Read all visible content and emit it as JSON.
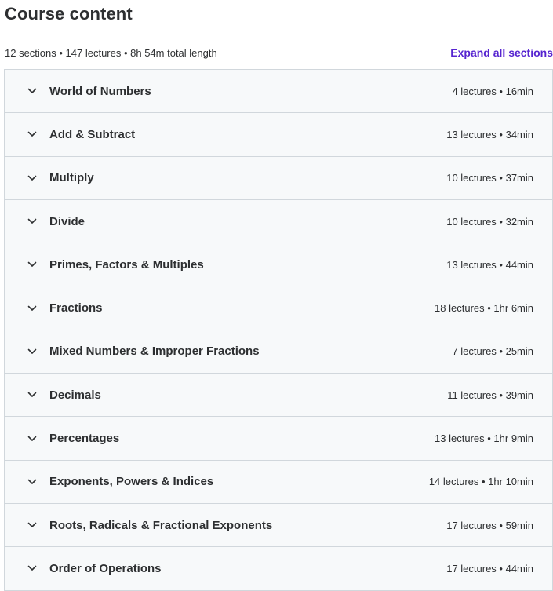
{
  "header": {
    "title": "Course content",
    "summary": "12 sections • 147 lectures • 8h 54m total length",
    "expand_label": "Expand all sections"
  },
  "colors": {
    "accent": "#5624d0",
    "section_bg": "#f7f9fa",
    "border": "#d1d7dc",
    "text": "#2d2f31"
  },
  "sections": [
    {
      "title": "World of Numbers",
      "info": "4 lectures • 16min",
      "icon": "chevron-down-icon"
    },
    {
      "title": "Add & Subtract",
      "info": "13 lectures • 34min",
      "icon": "chevron-down-icon"
    },
    {
      "title": "Multiply",
      "info": "10 lectures • 37min",
      "icon": "chevron-down-icon"
    },
    {
      "title": "Divide",
      "info": "10 lectures • 32min",
      "icon": "chevron-down-icon"
    },
    {
      "title": "Primes, Factors & Multiples",
      "info": "13 lectures • 44min",
      "icon": "chevron-down-icon"
    },
    {
      "title": "Fractions",
      "info": "18 lectures • 1hr 6min",
      "icon": "chevron-down-icon"
    },
    {
      "title": "Mixed Numbers & Improper Fractions",
      "info": "7 lectures • 25min",
      "icon": "chevron-down-icon"
    },
    {
      "title": "Decimals",
      "info": "11 lectures • 39min",
      "icon": "chevron-down-icon"
    },
    {
      "title": "Percentages",
      "info": "13 lectures • 1hr 9min",
      "icon": "chevron-down-icon"
    },
    {
      "title": "Exponents, Powers & Indices",
      "info": "14 lectures • 1hr 10min",
      "icon": "chevron-down-icon"
    },
    {
      "title": "Roots, Radicals & Fractional Exponents",
      "info": "17 lectures • 59min",
      "icon": "chevron-down-icon"
    },
    {
      "title": "Order of Operations",
      "info": "17 lectures • 44min",
      "icon": "chevron-down-icon"
    }
  ]
}
